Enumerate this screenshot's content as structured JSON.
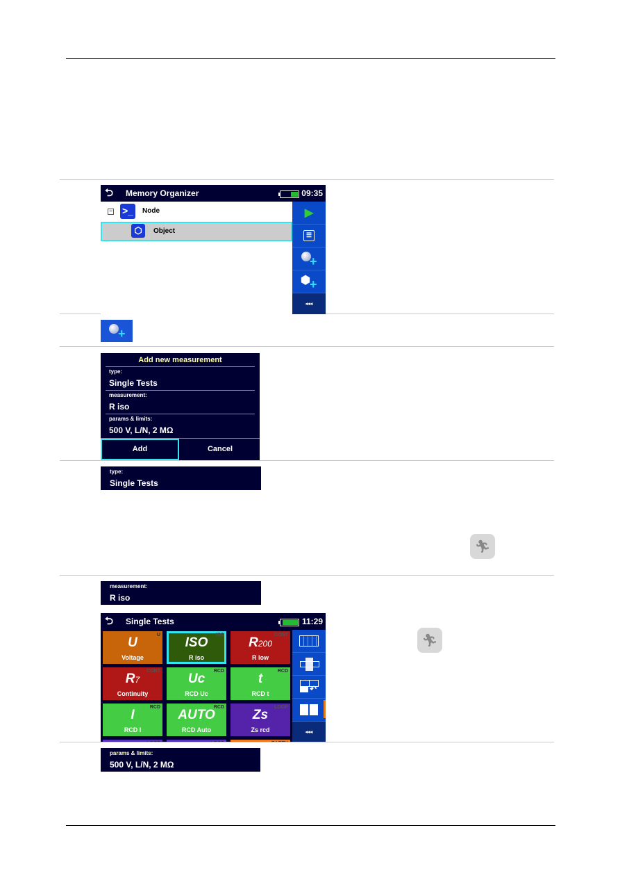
{
  "memory_organizer": {
    "title": "Memory Organizer",
    "time": "09:35",
    "battery_level": 0.4,
    "tree": [
      {
        "label": "Node",
        "icon": "node-prompt-icon",
        "expanded": true
      },
      {
        "label": "Object",
        "icon": "object-cube-icon",
        "selected": true
      }
    ],
    "side_buttons": [
      {
        "icon": "play-icon"
      },
      {
        "icon": "list-icon"
      },
      {
        "icon": "add-measurement-icon"
      },
      {
        "icon": "add-object-icon"
      },
      {
        "icon": "more-icon",
        "label": "◂◂◂"
      }
    ]
  },
  "add_measurement_button": {
    "icon": "add-measurement-icon"
  },
  "add_dialog": {
    "title": "Add new measurement",
    "fields": [
      {
        "label": "type:",
        "value": "Single Tests"
      },
      {
        "label": "measurement:",
        "value": "R iso"
      },
      {
        "label": "params & limits:",
        "value": "500 V, L/N, 2 MΩ"
      }
    ],
    "add_label": "Add",
    "cancel_label": "Cancel"
  },
  "type_field": {
    "label": "type:",
    "value": "Single Tests"
  },
  "measurement_field": {
    "label": "measurement:",
    "value": "R iso"
  },
  "params_field": {
    "label": "params & limits:",
    "value": "500 V, L/N, 2 MΩ"
  },
  "single_tests": {
    "title": "Single Tests",
    "time": "11:29",
    "battery_level": 1.0,
    "tiles": [
      {
        "symbol": "U",
        "sub": "",
        "label": "Voltage",
        "corner": "U",
        "color": "#c8650a"
      },
      {
        "symbol": "ISO",
        "sub": "",
        "label": "R iso",
        "corner": "ISO",
        "color": "#2e5a0a",
        "selected": true
      },
      {
        "symbol": "R",
        "sub": "200",
        "label": "R low",
        "corner": "CONT",
        "color": "#b01818"
      },
      {
        "symbol": "R",
        "sub": "7",
        "label": "Continuity",
        "corner": "CONT",
        "color": "#b01818"
      },
      {
        "symbol": "Uc",
        "sub": "",
        "label": "RCD Uc",
        "corner": "RCD",
        "color": "#44cc44"
      },
      {
        "symbol": "t",
        "sub": "",
        "label": "RCD t",
        "corner": "RCD",
        "color": "#44cc44"
      },
      {
        "symbol": "I",
        "sub": "",
        "label": "RCD I",
        "corner": "RCD",
        "color": "#44cc44"
      },
      {
        "symbol": "AUTO",
        "sub": "",
        "label": "RCD Auto",
        "corner": "RCD",
        "color": "#44cc44"
      },
      {
        "symbol": "Zs",
        "sub": "",
        "label": "Zs rcd",
        "corner": "LOOP",
        "color": "#5522aa"
      }
    ],
    "partial_tiles": [
      {
        "corner": "LOOP",
        "color": "#5533bb"
      },
      {
        "corner": "LOOP",
        "color": "#5533bb"
      },
      {
        "corner": "EARTH",
        "color": "#f07a20"
      }
    ],
    "side_buttons": [
      {
        "icon": "grid-view-icon"
      },
      {
        "icon": "center-view-icon"
      },
      {
        "icon": "swap-view-icon"
      },
      {
        "icon": "tile-view-icon"
      },
      {
        "icon": "more-icon",
        "label": "◂◂◂"
      }
    ]
  },
  "run_icon_1": {
    "icon": "run-icon"
  },
  "run_icon_2": {
    "icon": "run-icon"
  }
}
